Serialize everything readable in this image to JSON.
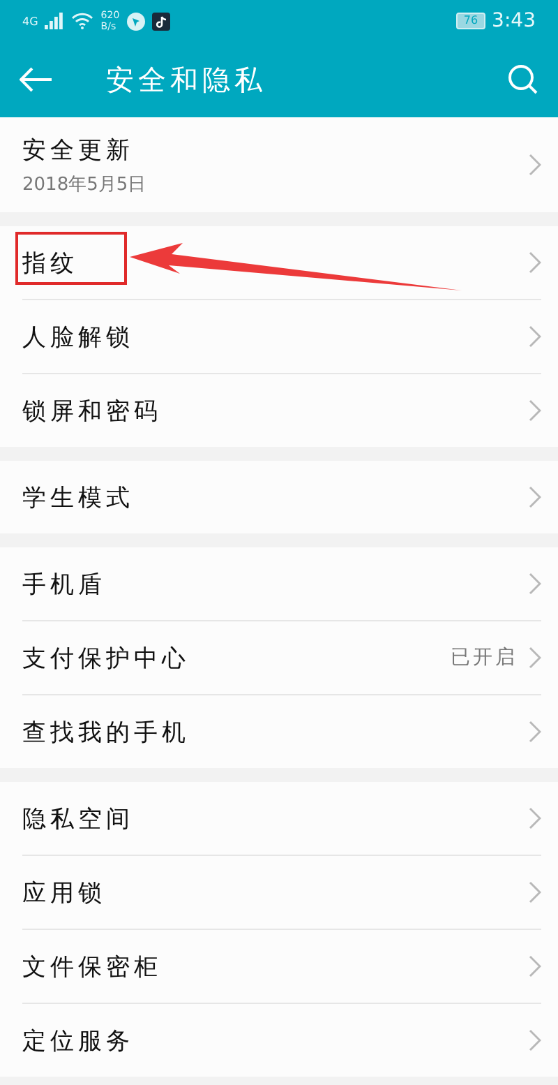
{
  "status_bar": {
    "network": "4G",
    "speed": "620",
    "speed_unit": "B/s",
    "battery": "76",
    "time": "3:43"
  },
  "app_bar": {
    "title": "安全和隐私"
  },
  "groups": [
    {
      "items": [
        {
          "title": "安全更新",
          "subtitle": "2018年5月5日",
          "highlighted": false
        }
      ]
    },
    {
      "items": [
        {
          "title": "指纹",
          "highlighted": true
        },
        {
          "title": "人脸解锁",
          "highlighted": false
        },
        {
          "title": "锁屏和密码",
          "highlighted": false
        }
      ]
    },
    {
      "items": [
        {
          "title": "学生模式",
          "highlighted": false
        }
      ]
    },
    {
      "items": [
        {
          "title": "手机盾",
          "highlighted": false
        },
        {
          "title": "支付保护中心",
          "value": "已开启",
          "highlighted": false
        },
        {
          "title": "查找我的手机",
          "highlighted": false
        }
      ]
    },
    {
      "items": [
        {
          "title": "隐私空间",
          "highlighted": false
        },
        {
          "title": "应用锁",
          "highlighted": false
        },
        {
          "title": "文件保密柜",
          "highlighted": false
        },
        {
          "title": "定位服务",
          "highlighted": false
        }
      ]
    }
  ]
}
